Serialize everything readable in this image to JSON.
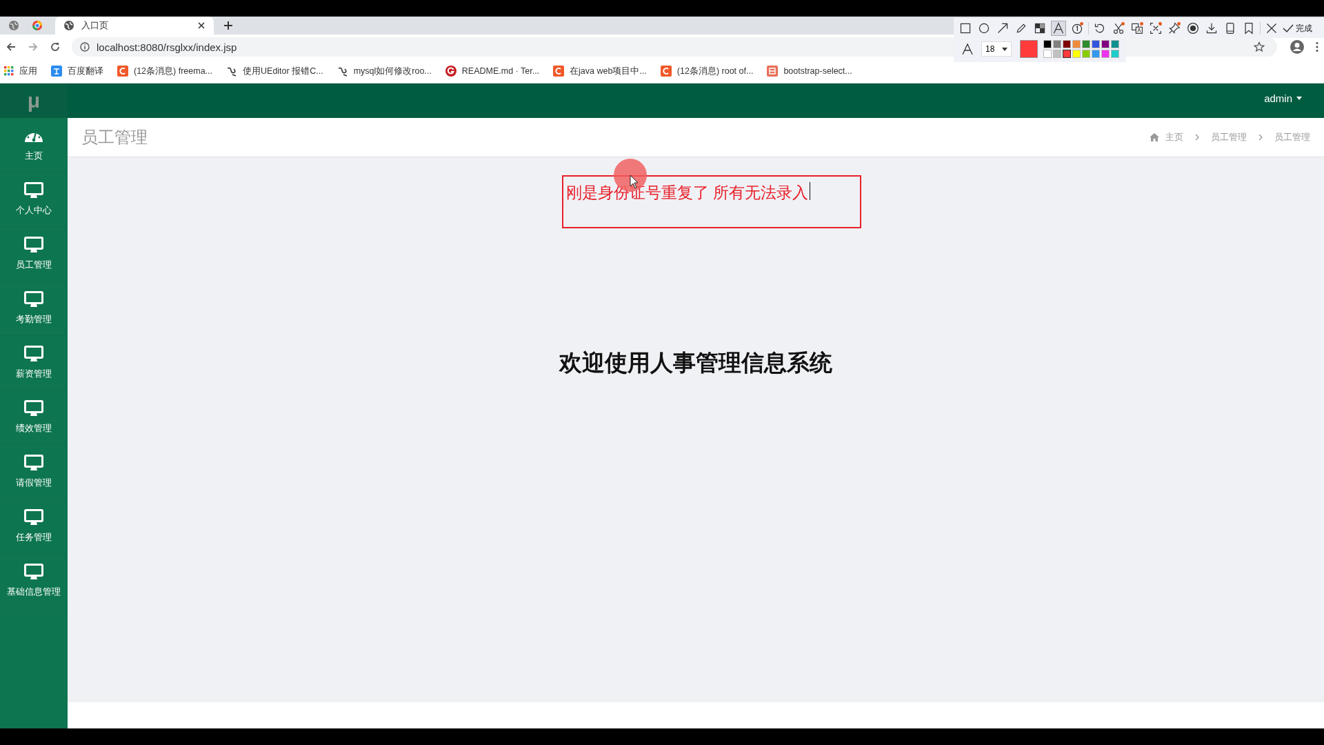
{
  "browser": {
    "tabs": [
      {
        "title": "入口页",
        "selected": true
      }
    ],
    "url": "localhost:8080/rsglxx/index.jsp",
    "bookmarks": [
      {
        "label": "应用",
        "kind": "apps"
      },
      {
        "label": "百度翻译",
        "kind": "translate"
      },
      {
        "label": "(12条消息) freema...",
        "kind": "csdn"
      },
      {
        "label": "使用UEditor 报错C...",
        "kind": "swirl"
      },
      {
        "label": "mysql如何修改roo...",
        "kind": "swirl"
      },
      {
        "label": "README.md · Ter...",
        "kind": "gitee"
      },
      {
        "label": "在java web项目中...",
        "kind": "csdn"
      },
      {
        "label": "(12条消息) root of...",
        "kind": "csdn"
      },
      {
        "label": "bootstrap-select...",
        "kind": "jian"
      }
    ]
  },
  "snip_toolbar": {
    "tools": [
      {
        "kind": "rect",
        "selected": false,
        "dot": false
      },
      {
        "kind": "ellipse",
        "selected": false,
        "dot": false
      },
      {
        "kind": "arrow",
        "selected": false,
        "dot": false
      },
      {
        "kind": "pencil",
        "selected": false,
        "dot": false
      },
      {
        "kind": "mosaic",
        "selected": false,
        "dot": false
      },
      {
        "kind": "text",
        "selected": true,
        "dot": false
      },
      {
        "kind": "number",
        "selected": false,
        "dot": true
      },
      {
        "kind": "undo",
        "selected": false,
        "dot": false
      },
      {
        "kind": "scissors",
        "selected": false,
        "dot": true
      },
      {
        "kind": "translate",
        "selected": false,
        "dot": true
      },
      {
        "kind": "ocr",
        "selected": false,
        "dot": true
      },
      {
        "kind": "pin",
        "selected": false,
        "dot": true
      },
      {
        "kind": "record",
        "selected": false,
        "dot": false
      },
      {
        "kind": "download",
        "selected": false,
        "dot": false
      },
      {
        "kind": "phone",
        "selected": false,
        "dot": false
      },
      {
        "kind": "bookmark",
        "selected": false,
        "dot": false
      },
      {
        "kind": "close",
        "selected": false,
        "dot": false
      }
    ],
    "done_label": "完成",
    "font_size": "18",
    "palette": [
      {
        "color": "#000000",
        "selected": false
      },
      {
        "color": "#808080",
        "selected": false
      },
      {
        "color": "#800000",
        "selected": false
      },
      {
        "color": "#f08a3c",
        "selected": false
      },
      {
        "color": "#2e8b2e",
        "selected": false
      },
      {
        "color": "#3355dd",
        "selected": false
      },
      {
        "color": "#800080",
        "selected": false
      },
      {
        "color": "#109090",
        "selected": false
      },
      {
        "color": "#ffffff",
        "selected": false
      },
      {
        "color": "#c0c0c0",
        "selected": false
      },
      {
        "color": "#ff3b3b",
        "selected": true
      },
      {
        "color": "#ffff00",
        "selected": false
      },
      {
        "color": "#88cc00",
        "selected": false
      },
      {
        "color": "#3399ee",
        "selected": false
      },
      {
        "color": "#ee33ee",
        "selected": false
      },
      {
        "color": "#22cccc",
        "selected": false
      }
    ]
  },
  "header": {
    "user": "admin"
  },
  "sidebar": {
    "logo": "μ",
    "items": [
      {
        "label": "主页",
        "kind": "dashboard"
      },
      {
        "label": "个人中心",
        "kind": "monitor"
      },
      {
        "label": "员工管理",
        "kind": "monitor"
      },
      {
        "label": "考勤管理",
        "kind": "monitor"
      },
      {
        "label": "薪资管理",
        "kind": "monitor"
      },
      {
        "label": "绩效管理",
        "kind": "monitor"
      },
      {
        "label": "请假管理",
        "kind": "monitor"
      },
      {
        "label": "任务管理",
        "kind": "monitor"
      },
      {
        "label": "基础信息管理",
        "kind": "monitor"
      }
    ]
  },
  "page": {
    "title": "员工管理",
    "breadcrumb": [
      "主页",
      "员工管理",
      "员工管理"
    ],
    "heading": "欢迎使用人事管理信息系统"
  },
  "annotation": {
    "text": "刚是身份证号重复了 所有无法录入"
  }
}
